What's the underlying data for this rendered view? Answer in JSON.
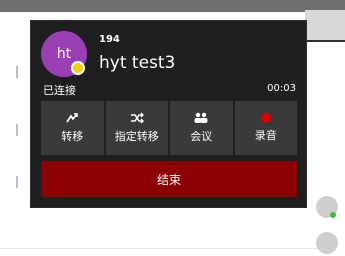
{
  "call": {
    "avatar_initials": "ht",
    "extension": "194",
    "name": "hyt test3",
    "status": "已连接",
    "timer": "00:03",
    "actions": [
      {
        "label": "转移",
        "icon": "transfer-icon"
      },
      {
        "label": "指定转移",
        "icon": "shuffle-icon"
      },
      {
        "label": "会议",
        "icon": "users-icon"
      },
      {
        "label": "录音",
        "icon": "record-icon"
      }
    ],
    "end_label": "结束"
  },
  "colors": {
    "panel": "#1f1f1f",
    "button": "#3a3a3a",
    "end_button": "#8b0000",
    "avatar": "#9b3fb5",
    "status_dot": "#f5d000",
    "record_dot": "#e00000"
  }
}
